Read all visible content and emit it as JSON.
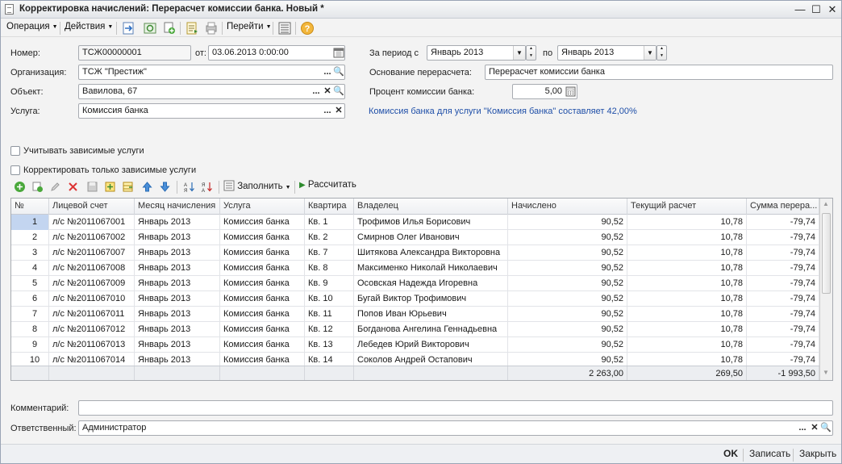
{
  "window": {
    "title": "Корректировка начислений: Перерасчет комиссии банка. Новый *",
    "minimize": "—",
    "maximize": "☐",
    "close": "✕"
  },
  "toolbar": {
    "operation": "Операция",
    "actions": "Действия",
    "goto": "Перейти"
  },
  "form": {
    "number_label": "Номер:",
    "number_value": "ТСЖ00000001",
    "date_label": "от:",
    "date_value": "03.06.2013  0:00:00",
    "org_label": "Организация:",
    "org_value": "ТСЖ \"Престиж\"",
    "object_label": "Объект:",
    "object_value": "Вавилова, 67",
    "service_label": "Услуга:",
    "service_value": "Комиссия банка",
    "period_label": "За период с",
    "period_from": "Январь 2013",
    "period_to_label": "по",
    "period_to": "Январь 2013",
    "reason_label": "Основание перерасчета:",
    "reason_value": "Перерасчет комиссии банка",
    "percent_label": "Процент комиссии банка:",
    "percent_value": "5,00",
    "note": "Комиссия банка для услуги \"Комиссия банка\" составляет 42,00%",
    "chk_dependent": "Учитывать зависимые услуги",
    "chk_only_dependent": "Корректировать только зависимые услуги"
  },
  "grid_toolbar": {
    "fill": "Заполнить",
    "calculate": "Рассчитать"
  },
  "table": {
    "columns": [
      "№",
      "Лицевой счет",
      "Месяц начисления",
      "Услуга",
      "Квартира",
      "Владелец",
      "Начислено",
      "Текущий расчет",
      "Сумма перера..."
    ],
    "rows": [
      [
        "1",
        "л/с №2011067001",
        "Январь 2013",
        "Комиссия банка",
        "Кв. 1",
        "Трофимов Илья Борисович",
        "90,52",
        "10,78",
        "-79,74"
      ],
      [
        "2",
        "л/с №2011067002",
        "Январь 2013",
        "Комиссия банка",
        "Кв. 2",
        "Смирнов Олег Иванович",
        "90,52",
        "10,78",
        "-79,74"
      ],
      [
        "3",
        "л/с №2011067007",
        "Январь 2013",
        "Комиссия банка",
        "Кв. 7",
        "Шитякова Александра Викторовна",
        "90,52",
        "10,78",
        "-79,74"
      ],
      [
        "4",
        "л/с №2011067008",
        "Январь 2013",
        "Комиссия банка",
        "Кв. 8",
        "Максименко Николай Николаевич",
        "90,52",
        "10,78",
        "-79,74"
      ],
      [
        "5",
        "л/с №2011067009",
        "Январь 2013",
        "Комиссия банка",
        "Кв. 9",
        "Осовская Надежда Игоревна",
        "90,52",
        "10,78",
        "-79,74"
      ],
      [
        "6",
        "л/с №2011067010",
        "Январь 2013",
        "Комиссия банка",
        "Кв. 10",
        "Бугай Виктор Трофимович",
        "90,52",
        "10,78",
        "-79,74"
      ],
      [
        "7",
        "л/с №2011067011",
        "Январь 2013",
        "Комиссия банка",
        "Кв. 11",
        "Попов Иван Юрьевич",
        "90,52",
        "10,78",
        "-79,74"
      ],
      [
        "8",
        "л/с №2011067012",
        "Январь 2013",
        "Комиссия банка",
        "Кв. 12",
        "Богданова Ангелина Геннадьевна",
        "90,52",
        "10,78",
        "-79,74"
      ],
      [
        "9",
        "л/с №2011067013",
        "Январь 2013",
        "Комиссия банка",
        "Кв. 13",
        "Лебедев Юрий Викторович",
        "90,52",
        "10,78",
        "-79,74"
      ],
      [
        "10",
        "л/с №2011067014",
        "Январь 2013",
        "Комиссия банка",
        "Кв. 14",
        "Соколов Андрей Остапович",
        "90,52",
        "10,78",
        "-79,74"
      ]
    ],
    "totals": {
      "accrued": "2 263,00",
      "current": "269,50",
      "recalc": "-1 993,50"
    }
  },
  "comment_label": "Комментарий:",
  "comment_value": "",
  "responsible_label": "Ответственный:",
  "responsible_value": "Администратор",
  "buttons": {
    "ok": "OK",
    "save": "Записать",
    "close": "Закрыть"
  },
  "colors": {
    "note": "#1f4fa8",
    "selected_row": "#c3d5f0"
  }
}
